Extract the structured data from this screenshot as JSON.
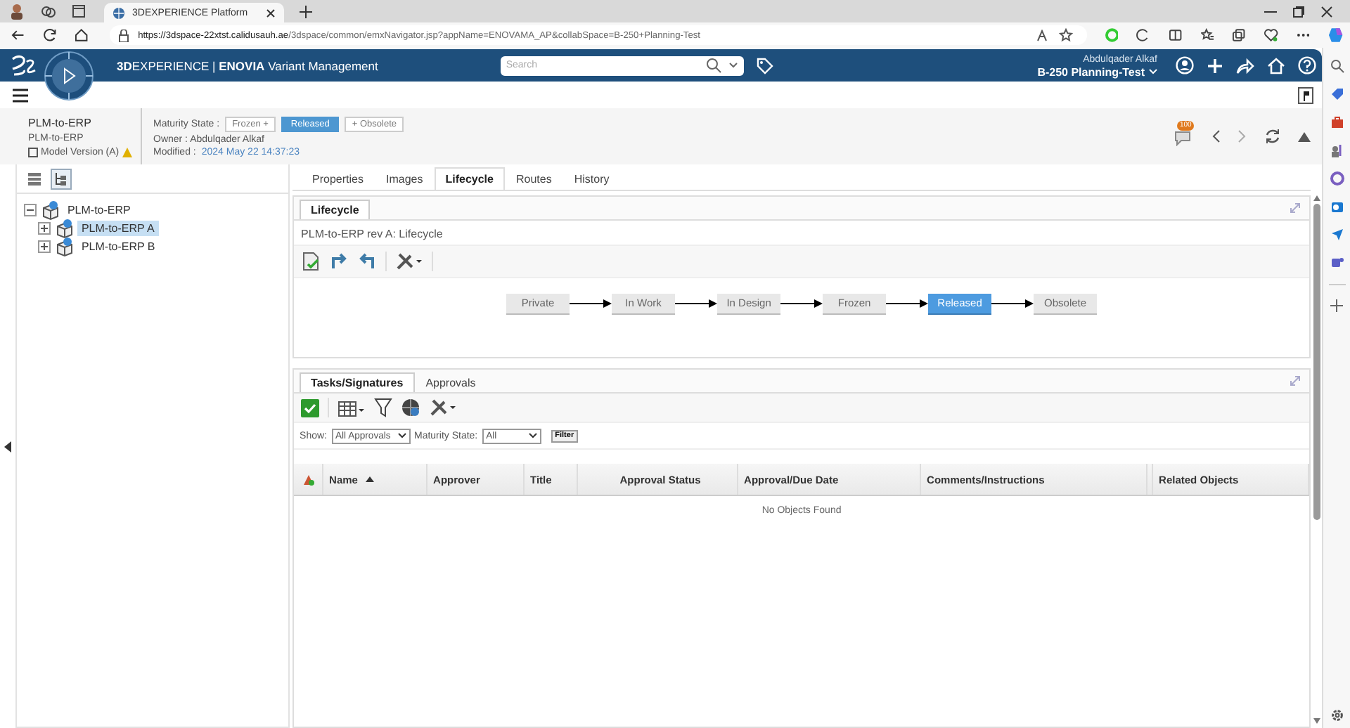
{
  "browser": {
    "tabs": [
      {
        "title": "3DEXPERIENCE Platform",
        "selected": true
      }
    ],
    "url_host": "https://3dspace-22xtst.calidusauh.ae",
    "url_path": "/3dspace/common/emxNavigator.jsp?appName=ENOVAMA_AP&collabSpace=B-250+Planning-Test"
  },
  "topbar": {
    "title": "**3D**EXPERIENCE | **ENOVIA** Variant Management",
    "search_placeholder": "Search",
    "user": "Abdulqader Alkaf",
    "collab_space": "B-250 Planning-Test"
  },
  "header": {
    "name": "PLM-to-ERP",
    "subname": "PLM-to-ERP",
    "type": "Model Version (A)",
    "maturity_label": "Maturity State :",
    "states": [
      {
        "label": "Frozen +",
        "selected": false
      },
      {
        "label": "Released",
        "selected": true
      },
      {
        "label": "+ Obsolete",
        "selected": false
      }
    ],
    "owner": "Owner : Abdulqader Alkaf",
    "modified_label": "Modified :",
    "modified": "2024 May 22 14:37:23",
    "notification_count": "100"
  },
  "tree": [
    {
      "label": "PLM-to-ERP",
      "expanded": true,
      "selected": false,
      "children": [
        {
          "label": "PLM-to-ERP A",
          "expanded": false,
          "selected": true
        },
        {
          "label": "PLM-to-ERP B",
          "expanded": false,
          "selected": false
        }
      ]
    }
  ],
  "tabs": [
    {
      "label": "Properties",
      "selected": false
    },
    {
      "label": "Images",
      "selected": false
    },
    {
      "label": "Lifecycle",
      "selected": true
    },
    {
      "label": "Routes",
      "selected": false
    },
    {
      "label": "History",
      "selected": false
    }
  ],
  "lifecycle": {
    "subtabs": [
      {
        "label": "Lifecycle",
        "selected": true
      }
    ],
    "heading": "PLM-to-ERP rev A: Lifecycle",
    "states": [
      {
        "label": "Private",
        "current": false
      },
      {
        "label": "In Work",
        "current": false
      },
      {
        "label": "In Design",
        "current": false
      },
      {
        "label": "Frozen",
        "current": false
      },
      {
        "label": "Released",
        "current": true
      },
      {
        "label": "Obsolete",
        "current": false
      }
    ]
  },
  "approvals": {
    "tabs": [
      {
        "label": "Tasks/Signatures",
        "selected": true
      },
      {
        "label": "Approvals",
        "selected": false
      }
    ],
    "show_label": "Show:",
    "show_value": "All Approvals",
    "maturity_label": "Maturity State:",
    "maturity_value": "All",
    "filter_button": "Filter",
    "columns": [
      {
        "label": "Name",
        "sorted": true
      },
      {
        "label": "Approver",
        "sorted": false
      },
      {
        "label": "Title",
        "sorted": false
      },
      {
        "label": "Approval Status",
        "sorted": false
      },
      {
        "label": "Approval/Due Date",
        "sorted": false
      },
      {
        "label": "Comments/Instructions",
        "sorted": false
      },
      {
        "label": "Related Objects",
        "sorted": false
      }
    ],
    "empty_message": "No Objects Found"
  }
}
